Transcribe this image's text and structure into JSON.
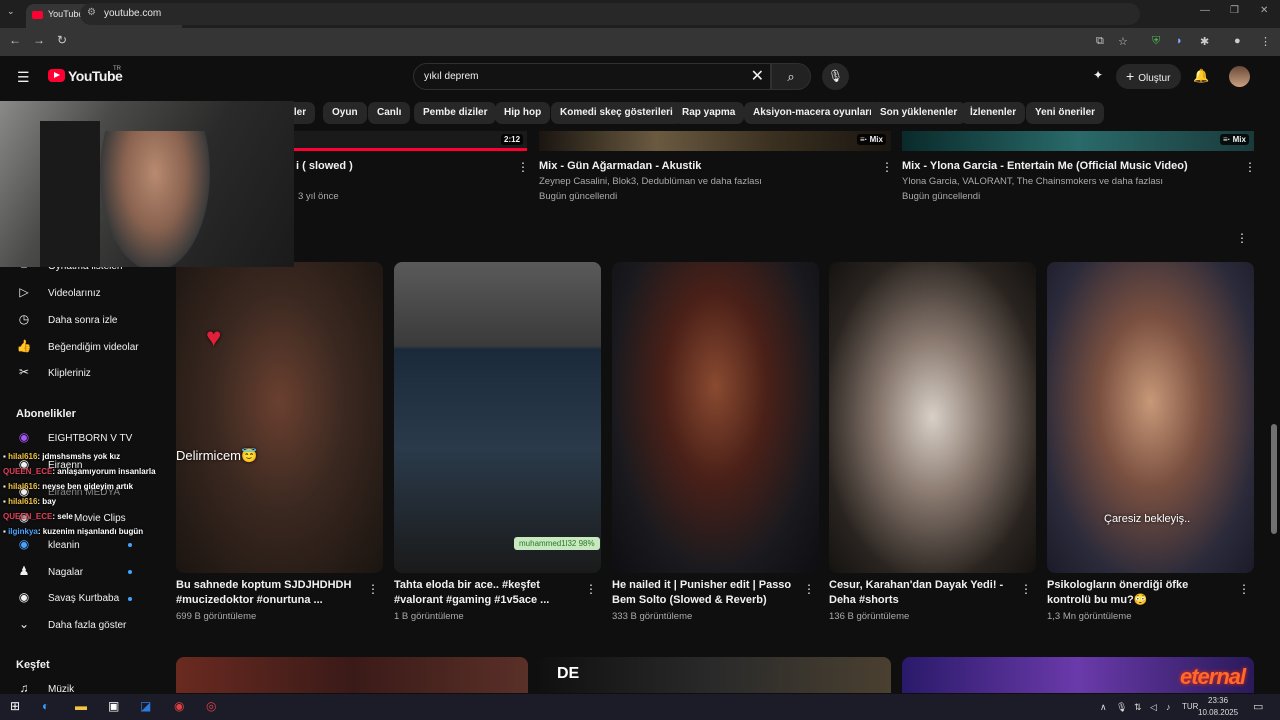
{
  "browser": {
    "tab_title": "YouTube",
    "url": "youtube.com"
  },
  "header": {
    "logo_text": "YouTube",
    "logo_region": "TR",
    "search_query": "yıkıl deprem",
    "create_label": "Oluştur"
  },
  "chips": [
    "rler",
    "Oyun",
    "Canlı",
    "Pembe diziler",
    "Hip hop",
    "Komedi skeç gösterileri",
    "Rap yapma",
    "Aksiyon-macera oyunları",
    "Son yüklenenler",
    "İzlenenler",
    "Yeni öneriler"
  ],
  "top_videos": [
    {
      "title": "i ( slowed )",
      "meta1": "",
      "meta2": "3 yıl önce",
      "duration": "2:12"
    },
    {
      "title": "Mix - Gün Ağarmadan - Akustik",
      "meta1": "Zeynep Casalini, Blok3, Dedublüman ve daha fazlası",
      "meta2": "Bugün güncellendi",
      "duration": "Mix"
    },
    {
      "title": "Mix - Ylona Garcia - Entertain Me (Official Music Video)",
      "meta1": "Ylona Garcia, VALORANT, The Chainsmokers ve daha fazlası",
      "meta2": "Bugün güncellendi",
      "duration": "Mix"
    }
  ],
  "sidebar": {
    "items": [
      {
        "label": "Oynatma listeleri"
      },
      {
        "label": "Videolarınız"
      },
      {
        "label": "Daha sonra izle"
      },
      {
        "label": "Beğendiğim videolar"
      },
      {
        "label": "Klipleriniz"
      }
    ],
    "subscriptions_heading": "Abonelikler",
    "subscriptions": [
      {
        "label": "EIGHTBORN V TV"
      },
      {
        "label": "Eiraenn"
      },
      {
        "label": "Elraenn MEDYA"
      },
      {
        "label": "Movie Clips"
      },
      {
        "label": "kleanin"
      },
      {
        "label": "Nagalar"
      },
      {
        "label": "Savaş Kurtbaba"
      }
    ],
    "show_more": "Daha fazla göster",
    "explore_heading": "Keşfet",
    "explore": [
      {
        "label": "Müzik"
      }
    ]
  },
  "chat": [
    {
      "user": "hilal616",
      "msg": ": jdmshsmshs yok kız"
    },
    {
      "user": "QUEEN_ECE",
      "msg": ": anlaşamıyorum insanlarla"
    },
    {
      "user": "hilal616",
      "msg": ": neyse ben gideyim artık"
    },
    {
      "user": "hilal616",
      "msg": ": bay"
    },
    {
      "user": "QUEEN_ECE",
      "msg": ": sele"
    },
    {
      "user": "ilginkya",
      "msg": ": kuzenim nişanlandı bugün"
    }
  ],
  "shorts": [
    {
      "title": "Bu sahnede koptum SJDJHDHDH #mucizedoktor #onurtuna ...",
      "views": "699 B görüntüleme",
      "overlay": "Delirmicem😇"
    },
    {
      "title": "Tahta eloda bir ace..  #keşfet #valorant #gaming #1v5ace ...",
      "views": "1 B görüntüleme",
      "overlay": "muhammed1l32 98%"
    },
    {
      "title": "He nailed it | Punisher edit | Passo Bem Solto (Slowed & Reverb)",
      "views": "333 B görüntüleme",
      "overlay": ""
    },
    {
      "title": "Cesur, Karahan'dan Dayak Yedi! - Deha #shorts",
      "views": "136 B görüntüleme",
      "overlay": ""
    },
    {
      "title": "Psikologların önerdiği öfke kontrolü bu mu?😳",
      "views": "1,3 Mn görüntüleme",
      "overlay": "Çaresiz bekleyiş.."
    }
  ],
  "stream_logo": "eternal",
  "taskbar": {
    "lang": "TUR",
    "time": "23:36",
    "date": "10.08.2025"
  },
  "colors": {
    "accent_red": "#ff0033",
    "bg": "#0f0f0f",
    "chip_bg": "#272727"
  }
}
